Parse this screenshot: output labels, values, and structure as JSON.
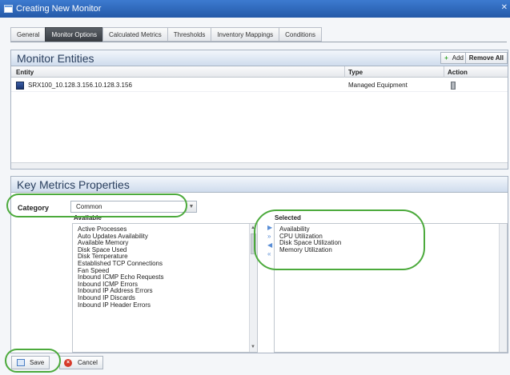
{
  "window": {
    "title": "Creating New Monitor"
  },
  "tabs": [
    {
      "label": "General"
    },
    {
      "label": "Monitor Options"
    },
    {
      "label": "Calculated Metrics"
    },
    {
      "label": "Thresholds"
    },
    {
      "label": "Inventory Mappings"
    },
    {
      "label": "Conditions"
    }
  ],
  "monitor_entities": {
    "title": "Monitor Entities",
    "add_label": "Add",
    "remove_all_label": "Remove All",
    "columns": {
      "entity": "Entity",
      "type": "Type",
      "action": "Action"
    },
    "rows": [
      {
        "entity": "SRX100_10.128.3.156.10.128.3.156",
        "type": "Managed Equipment"
      }
    ]
  },
  "key_metrics": {
    "title": "Key Metrics Properties",
    "category_label": "Category",
    "category_value": "Common",
    "available_label": "Available",
    "selected_label": "Selected",
    "available": [
      "Active Processes",
      "Auto Updates Availability",
      "Available Memory",
      "Disk Space Used",
      "Disk Temperature",
      "Established TCP Connections",
      "Fan Speed",
      "Inbound ICMP Echo Requests",
      "Inbound ICMP Errors",
      "Inbound IP Address Errors",
      "Inbound IP Discards",
      "Inbound IP Header Errors"
    ],
    "selected": [
      "Availability",
      "CPU Utilization",
      "Disk Space Utilization",
      "Memory Utilization"
    ]
  },
  "footer": {
    "save_label": "Save",
    "cancel_label": "Cancel"
  },
  "colors": {
    "highlight": "#4caa3c",
    "titlebar": "#2f68bd",
    "active_tab": "#454a51"
  }
}
